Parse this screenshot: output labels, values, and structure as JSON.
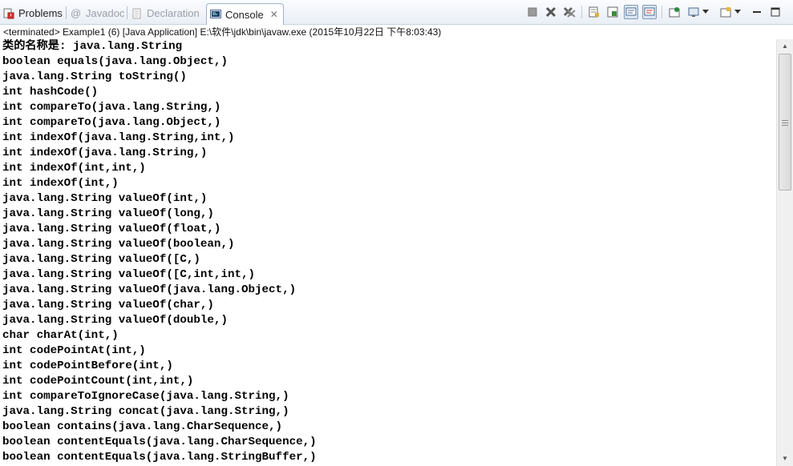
{
  "tabs": [
    {
      "label": "Problems",
      "icon": "problems-icon",
      "active": false,
      "dim": false
    },
    {
      "label": "Javadoc",
      "icon": "javadoc-icon",
      "active": false,
      "dim": true
    },
    {
      "label": "Declaration",
      "icon": "declaration-icon",
      "active": false,
      "dim": true
    },
    {
      "label": "Console",
      "icon": "console-icon",
      "active": true,
      "dim": false
    }
  ],
  "tab_close_glyph": "✕",
  "toolbar": [
    "terminate-icon",
    "remove-launch-icon",
    "remove-all-terminated-icon",
    "clear-console-icon",
    "scroll-lock-icon",
    "show-on-stdout-icon",
    "show-on-stderr-icon",
    "pin-console-icon",
    "display-selected-console-icon",
    "open-console-icon",
    "minimize-icon",
    "maximize-icon"
  ],
  "status": "<terminated> Example1 (6) [Java Application] E:\\软件\\jdk\\bin\\javaw.exe (2015年10月22日 下午8:03:43)",
  "console_lines": [
    "类的名称是: java.lang.String",
    "boolean equals(java.lang.Object,)",
    "java.lang.String toString()",
    "int hashCode()",
    "int compareTo(java.lang.String,)",
    "int compareTo(java.lang.Object,)",
    "int indexOf(java.lang.String,int,)",
    "int indexOf(java.lang.String,)",
    "int indexOf(int,int,)",
    "int indexOf(int,)",
    "java.lang.String valueOf(int,)",
    "java.lang.String valueOf(long,)",
    "java.lang.String valueOf(float,)",
    "java.lang.String valueOf(boolean,)",
    "java.lang.String valueOf([C,)",
    "java.lang.String valueOf([C,int,int,)",
    "java.lang.String valueOf(java.lang.Object,)",
    "java.lang.String valueOf(char,)",
    "java.lang.String valueOf(double,)",
    "char charAt(int,)",
    "int codePointAt(int,)",
    "int codePointBefore(int,)",
    "int codePointCount(int,int,)",
    "int compareToIgnoreCase(java.lang.String,)",
    "java.lang.String concat(java.lang.String,)",
    "boolean contains(java.lang.CharSequence,)",
    "boolean contentEquals(java.lang.CharSequence,)",
    "boolean contentEquals(java.lang.StringBuffer,)"
  ],
  "colors": {
    "tab_border": "#9fb0c9",
    "console_text": "#000000",
    "status_text": "#111111"
  }
}
